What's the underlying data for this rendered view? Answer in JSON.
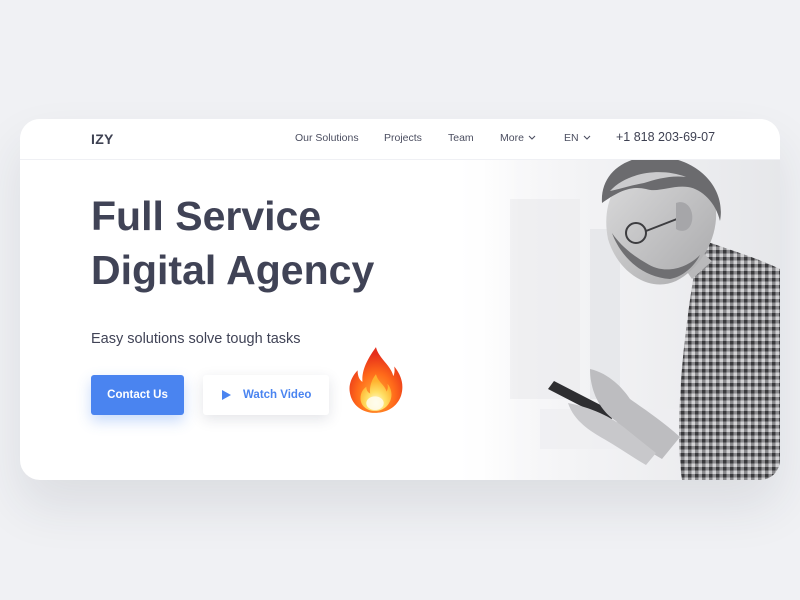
{
  "brand": {
    "logo": "IZY",
    "accent": "#4a84f0"
  },
  "nav": {
    "links": [
      "Our Solutions",
      "Projects",
      "Team"
    ],
    "more_label": "More",
    "language": "EN",
    "phone": "+1 818 203-69-07"
  },
  "hero": {
    "title_line1": "Full Service",
    "title_line2": "Digital Agency",
    "tagline": "Easy solutions solve tough tasks",
    "primary_button": "Contact Us",
    "secondary_button": "Watch Video"
  },
  "icons": {
    "menu_chevron": "chevron-down-icon",
    "video": "play-icon",
    "decoration": "fire-icon",
    "image": "man-with-phone-photo"
  }
}
